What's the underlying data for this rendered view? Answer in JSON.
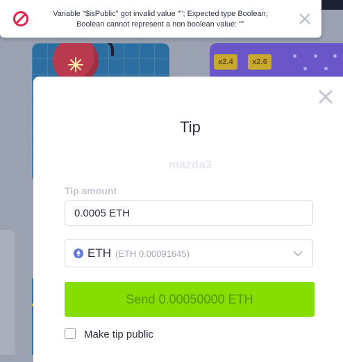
{
  "toast": {
    "message": "Variable \"$isPublic\" got invalid value \"\"; Expected type Boolean; Boolean cannot represent a non boolean value: \"\"",
    "icon": "prohibited-icon",
    "close_icon": "close-icon"
  },
  "background": {
    "multipliers": [
      "x2.4",
      "x2.6"
    ]
  },
  "modal": {
    "title": "Tip",
    "recipient": "mazda3",
    "amount_label": "Tip amount",
    "amount_value": "0.0005 ETH",
    "currency": {
      "code": "ETH",
      "balance": "(ETH 0.00091645)",
      "icon": "ethereum-icon"
    },
    "send_label": "Send 0.00050000 ETH",
    "public_label": "Make tip public",
    "public_checked": false
  },
  "colors": {
    "send_button": "#86dd00",
    "error_icon": "#e0264d"
  }
}
